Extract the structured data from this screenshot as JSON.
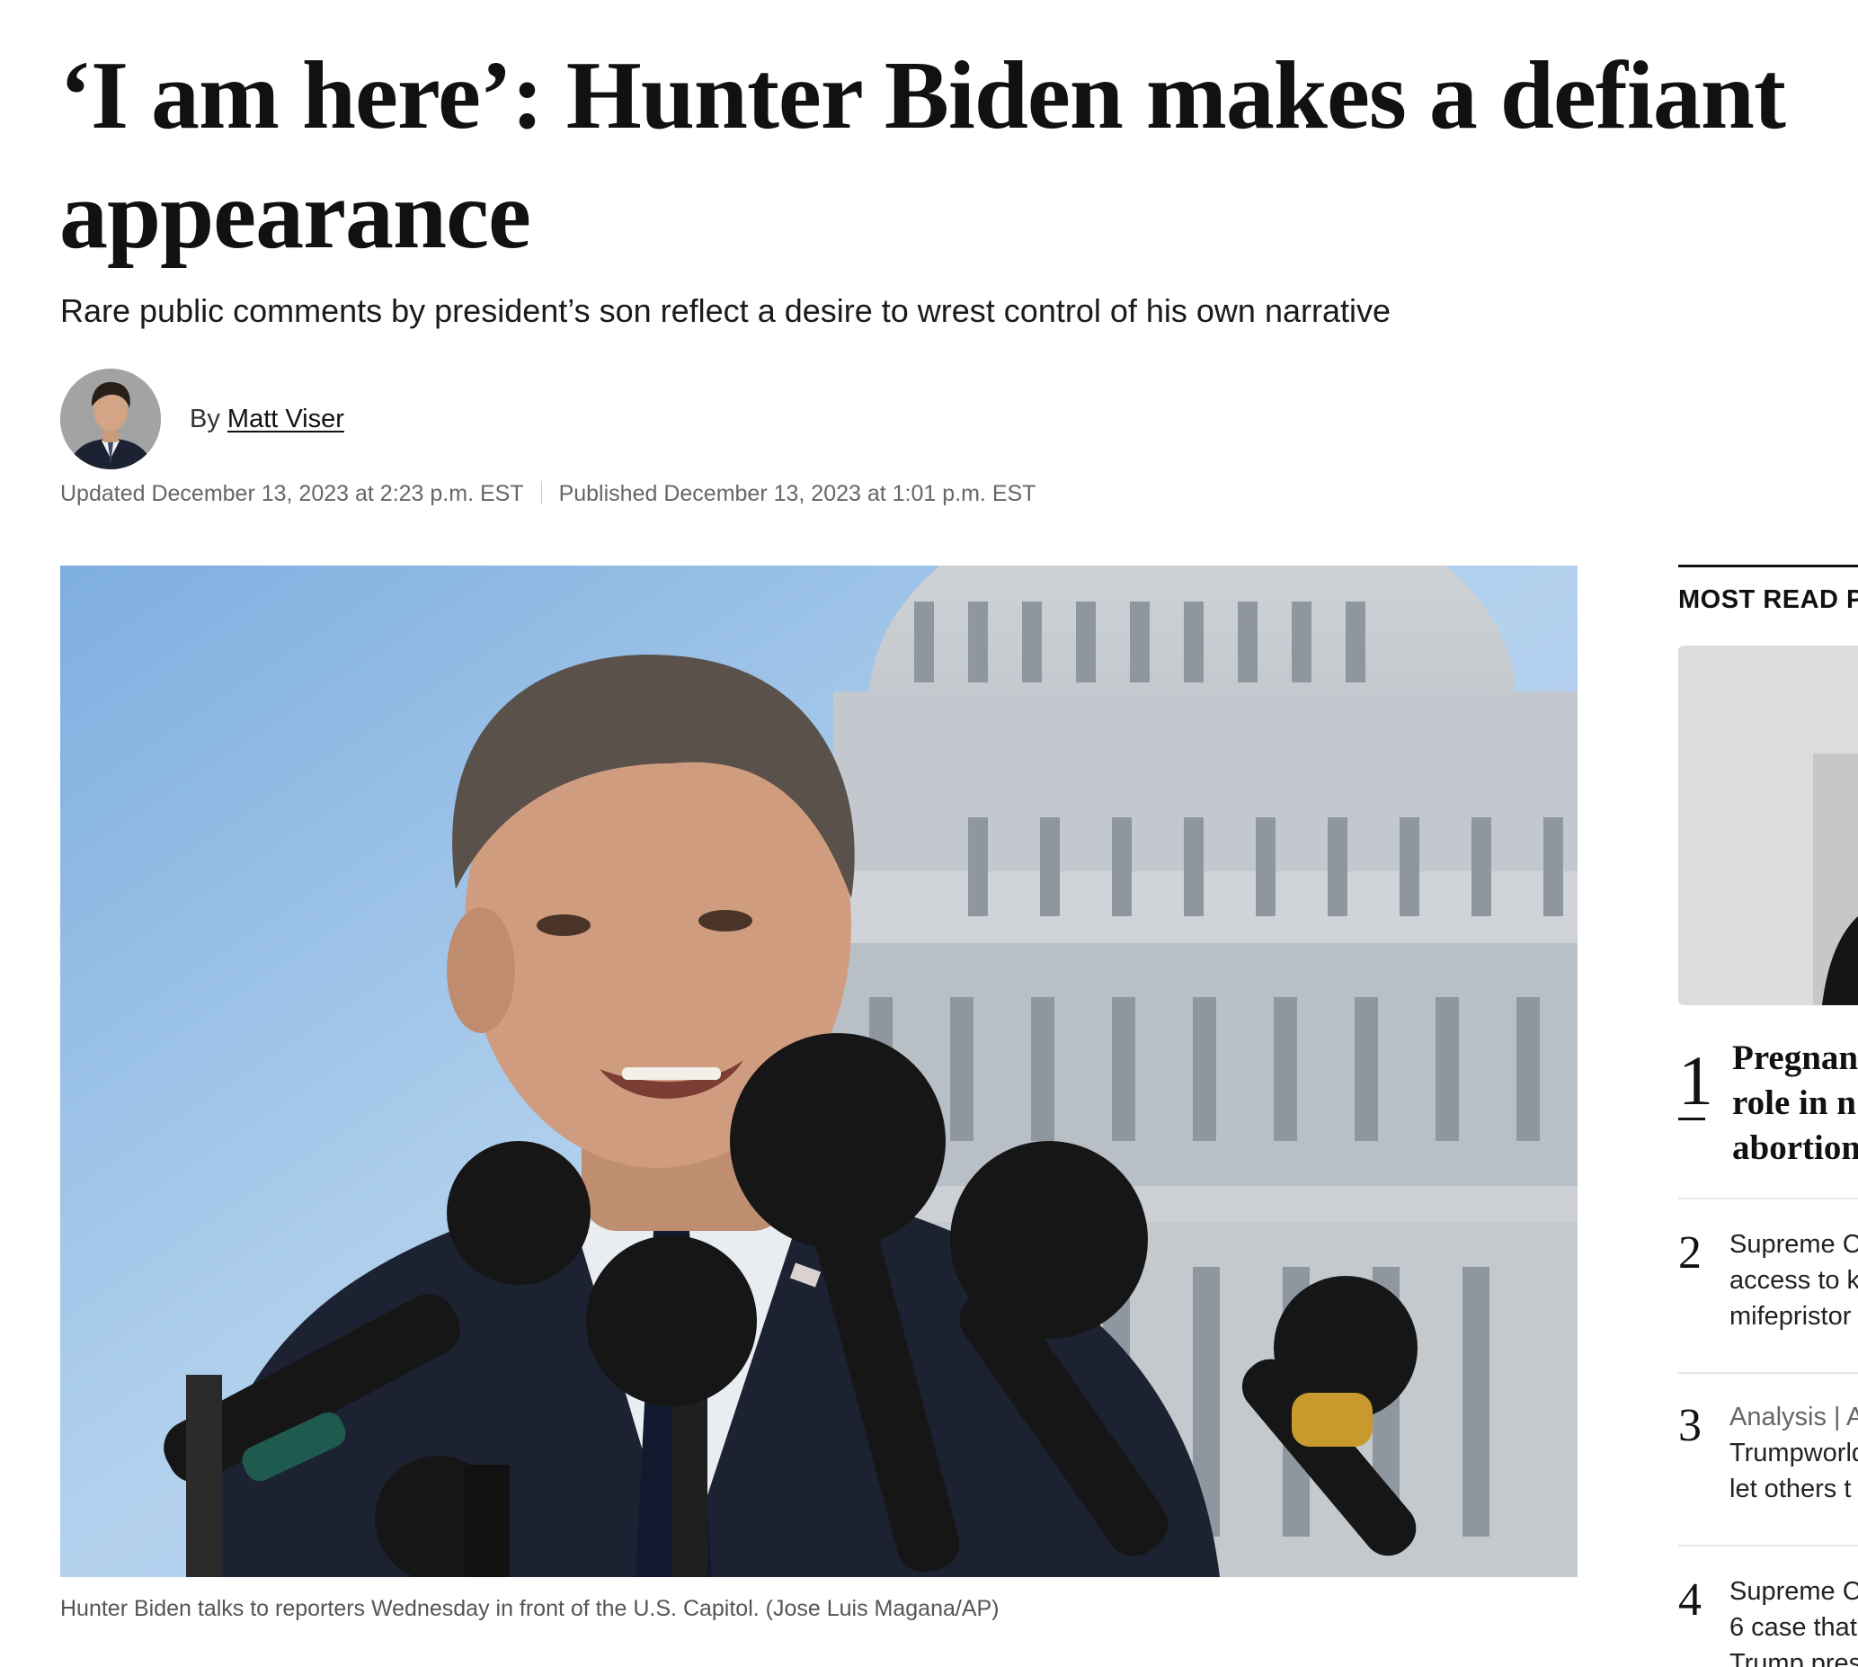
{
  "article": {
    "headline_line1": "‘I am here’: Hunter Biden makes a defiant",
    "headline_line2": "appearance",
    "dek": "Rare public comments by president’s son reflect a desire to wrest control of his own narrative",
    "byline_prefix": "By",
    "author": "Matt Viser",
    "updated": "Updated December 13, 2023 at 2:23 p.m. EST",
    "published": "Published December 13, 2023 at 1:01 p.m. EST",
    "caption": "Hunter Biden talks to reporters Wednesday in front of the U.S. Capitol. (Jose Luis Magana/AP)"
  },
  "most_read": {
    "title": "MOST READ P",
    "items": [
      {
        "rank": "1",
        "lines": [
          "Pregnan",
          "role in n",
          "abortion"
        ]
      },
      {
        "rank": "2",
        "lines": [
          "Supreme C",
          "access to k",
          "mifepristor"
        ]
      },
      {
        "rank": "3",
        "kicker": "Analysis",
        "kicker_rest": " | A",
        "lines": [
          "Trumpworld",
          "let others t"
        ]
      },
      {
        "rank": "4",
        "lines": [
          "Supreme C",
          "6 case that",
          "Trump pres"
        ]
      }
    ]
  },
  "colors": {
    "text": "#111111",
    "meta": "#666666",
    "caption": "#555555"
  }
}
